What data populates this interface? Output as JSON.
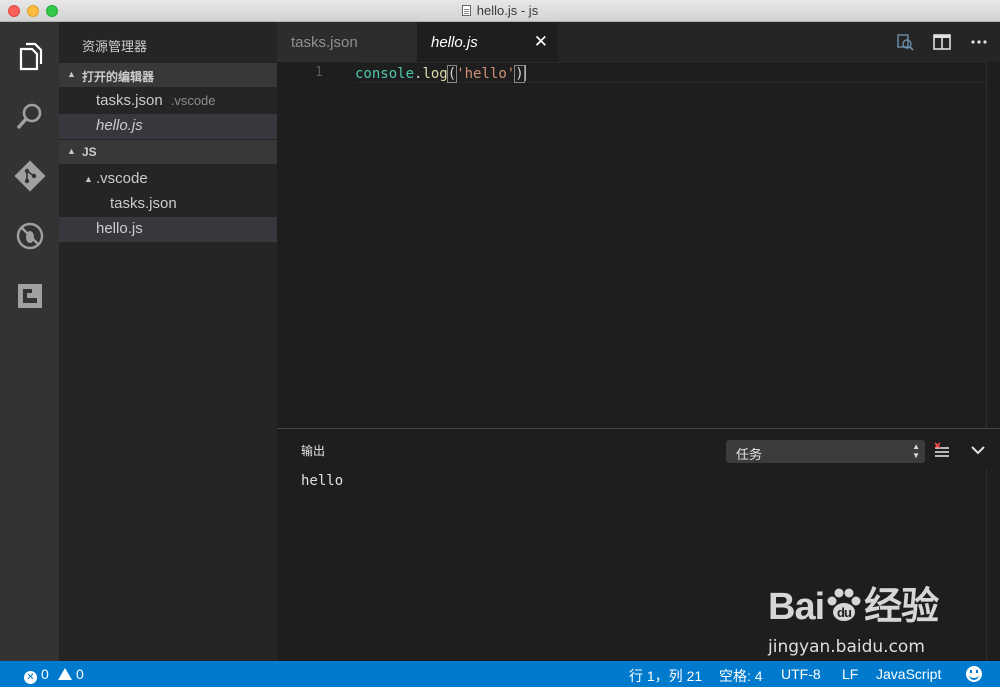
{
  "window": {
    "title": "hello.js - js"
  },
  "activity_bar": {
    "items": [
      "explorer-icon",
      "search-icon",
      "git-icon",
      "debug-icon",
      "extensions-icon"
    ]
  },
  "sidebar": {
    "title": "资源管理器",
    "open_editors": {
      "label": "打开的编辑器",
      "items": [
        {
          "name": "tasks.json",
          "description": ".vscode"
        },
        {
          "name": "hello.js"
        }
      ]
    },
    "folder": {
      "label": "JS",
      "items": [
        {
          "name": ".vscode"
        },
        {
          "name": "tasks.json"
        },
        {
          "name": "hello.js"
        }
      ]
    }
  },
  "tabs": [
    {
      "label": "tasks.json",
      "active": false
    },
    {
      "label": "hello.js",
      "active": true,
      "close": "✕"
    }
  ],
  "editor": {
    "line_number": "1",
    "code": {
      "object": "console",
      "dot": ".",
      "method": "log",
      "open_paren": "(",
      "string": "'hello'",
      "close_paren": ")"
    }
  },
  "panel": {
    "title": "输出",
    "channel": "任务",
    "output": "hello"
  },
  "statusbar": {
    "errors": "0",
    "warnings": "0",
    "position": "行 1，列 21",
    "indent": "空格: 4",
    "encoding": "UTF-8",
    "eol": "LF",
    "language": "JavaScript"
  },
  "watermark": {
    "brand": "Bai",
    "brand_tail": "du",
    "brand_cn": "经验",
    "url": "jingyan.baidu.com"
  },
  "colors": {
    "statusbar": "#007acc",
    "sidebar": "#252526",
    "editor": "#1e1e1e",
    "activitybar": "#333333"
  }
}
